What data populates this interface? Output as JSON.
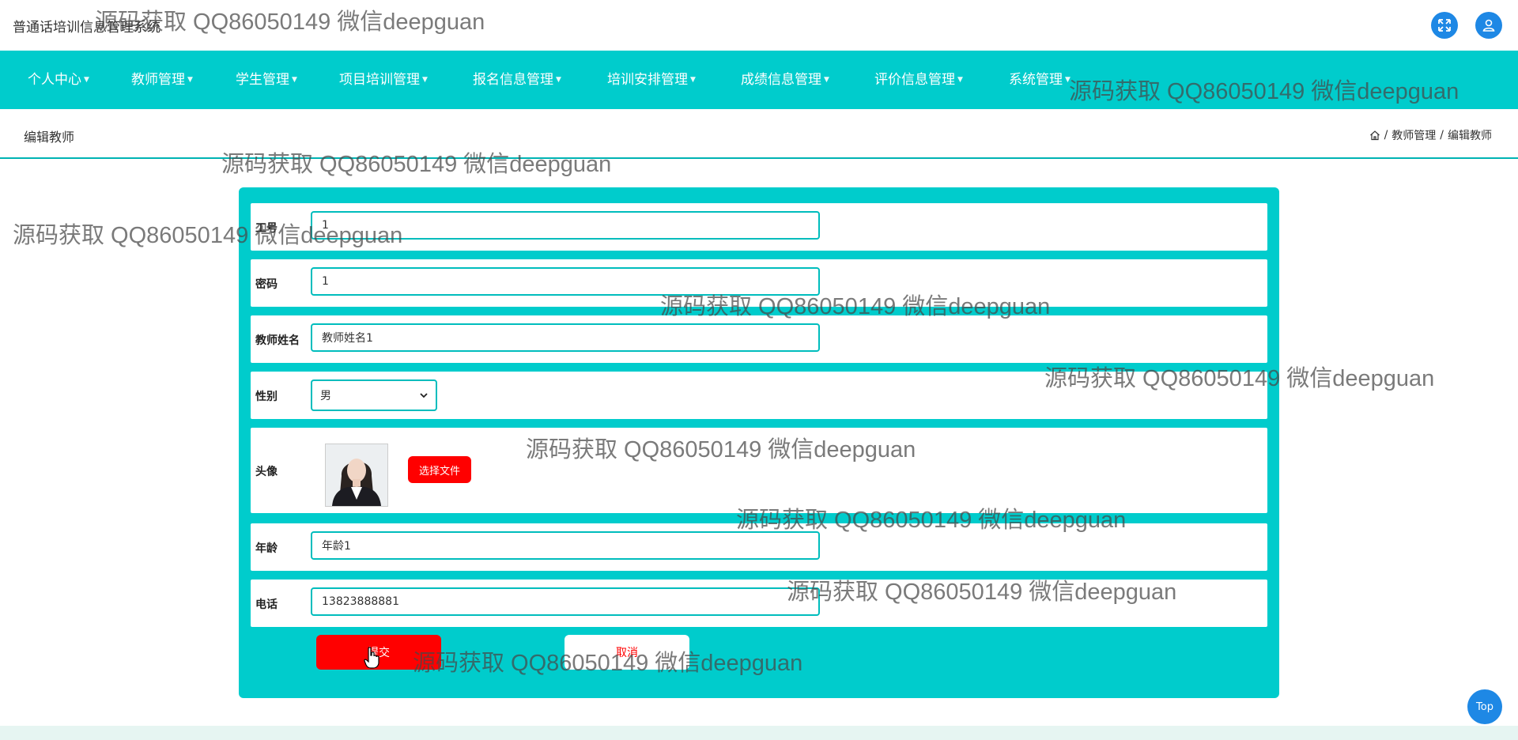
{
  "app": {
    "title": "普通话培训信息管理系统"
  },
  "header_icons": {
    "fullscreen": "expand-icon",
    "user": "user-icon",
    "accent": "#1e88e5"
  },
  "nav": {
    "background": "#00cccc",
    "items": [
      {
        "label": "个人中心"
      },
      {
        "label": "教师管理"
      },
      {
        "label": "学生管理"
      },
      {
        "label": "项目培训管理"
      },
      {
        "label": "报名信息管理"
      },
      {
        "label": "培训安排管理"
      },
      {
        "label": "成绩信息管理"
      },
      {
        "label": "评价信息管理"
      },
      {
        "label": "系统管理"
      }
    ]
  },
  "page": {
    "title": "编辑教师",
    "breadcrumb": {
      "home_icon": "home-icon",
      "level1": "教师管理",
      "sep": "/",
      "level2": "编辑教师"
    }
  },
  "form": {
    "fields": {
      "account": {
        "label": "工号",
        "value": "1"
      },
      "password": {
        "label": "密码",
        "value": "1"
      },
      "name": {
        "label": "教师姓名",
        "value": "教师姓名1"
      },
      "gender": {
        "label": "性别",
        "value": "男"
      },
      "avatar": {
        "label": "头像",
        "button": "选择文件"
      },
      "age": {
        "label": "年龄",
        "value": "年龄1"
      },
      "phone": {
        "label": "电话",
        "value": "13823888881"
      }
    },
    "submit_label": "提交",
    "cancel_label": "取消"
  },
  "top_button": "Top",
  "watermark": "源码获取 QQ86050149 微信deepguan",
  "colors": {
    "primary": "#00cccc",
    "danger": "#ff0000",
    "accent": "#1e88e5"
  }
}
